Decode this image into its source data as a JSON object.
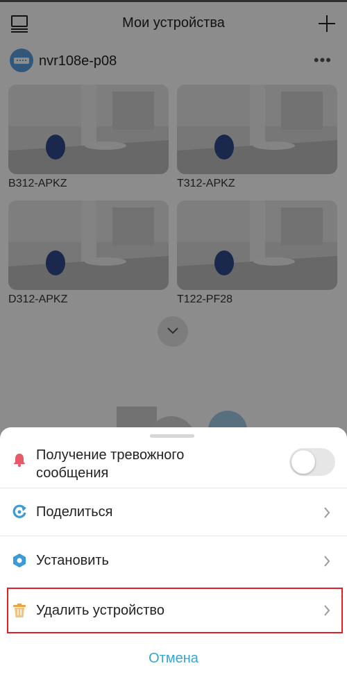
{
  "header": {
    "title": "Мои устройства",
    "left_icon": "device-list-icon",
    "right_icon": "plus-icon"
  },
  "device": {
    "name": "nvr108e-p08",
    "icon": "nvr-icon",
    "more_icon": "more-dots-icon"
  },
  "cameras": [
    {
      "label": "B312-APKZ"
    },
    {
      "label": "T312-APKZ"
    },
    {
      "label": "D312-APKZ"
    },
    {
      "label": "T122-PF28"
    }
  ],
  "expand_icon": "chevron-down-icon",
  "sheet": {
    "alarm": {
      "label_line1": "Получение тревожного",
      "label_line2": "сообщения",
      "icon": "bell-icon",
      "enabled": false
    },
    "share": {
      "label": "Поделиться",
      "icon": "share-icon"
    },
    "settings": {
      "label": "Установить",
      "icon": "settings-icon"
    },
    "delete": {
      "label": "Удалить устройство",
      "icon": "trash-icon"
    },
    "cancel_label": "Отмена"
  },
  "colors": {
    "accent": "#36a5cf",
    "alarm": "#e85a6a",
    "share": "#3a9bd7",
    "trash": "#e8a64a",
    "highlight": "#e01f26",
    "device": "#5aa0de"
  }
}
